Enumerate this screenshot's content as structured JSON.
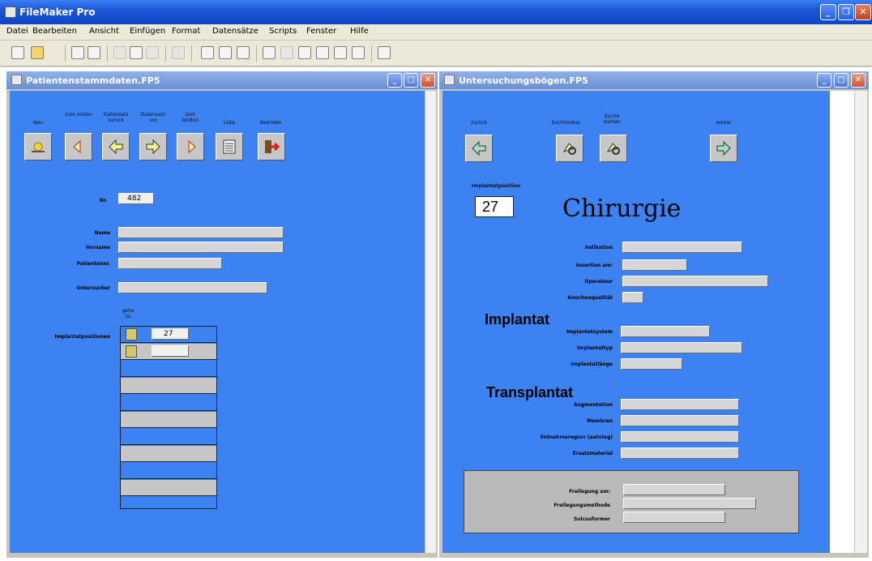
{
  "app": {
    "title": "FileMaker Pro"
  },
  "menu": [
    "Datei",
    "Bearbeiten",
    "Ansicht",
    "Einfügen",
    "Format",
    "Datensätze",
    "Scripts",
    "Fenster",
    "Hilfe"
  ],
  "left_window": {
    "title": "Patientenstammdaten.FP5",
    "nav": [
      {
        "label": "Neu",
        "icon": "sun-icon"
      },
      {
        "label": "zum ersten",
        "icon": "rewind-icon"
      },
      {
        "label": "Datensatz zurück",
        "icon": "arrow-left-icon"
      },
      {
        "label": "Datensatz vor",
        "icon": "arrow-right-icon"
      },
      {
        "label": "zum letzten",
        "icon": "fast-forward-icon"
      },
      {
        "label": "Liste",
        "icon": "list-icon"
      },
      {
        "label": "Beenden",
        "icon": "exit-icon"
      }
    ],
    "nr_label": "Nr.",
    "nr_value": "482",
    "name_label": "Name",
    "vorname_label": "Vorname",
    "patientennr_label": "Patientennr.",
    "untersucher_label": "Untersucher",
    "gehe_zu_label": "gehe zu",
    "implantat_label": "Implantatpositionen",
    "portal_values": [
      "27",
      ""
    ]
  },
  "right_window": {
    "title": "Untersuchungsbögen.FP5",
    "btn_zurueck": "zurück",
    "btn_suchmodus": "Suchmodus",
    "btn_suche_starten": "Suche starten",
    "btn_weiter": "weiter",
    "implantatposition_label": "Implantatposition",
    "implantatposition_value": "27",
    "heading": "Chirurgie",
    "indikation": "Indikation",
    "insertion": "Insertion am:",
    "operateur": "Operateur",
    "knochenqualitaet": "Knochenqualität",
    "implantat_heading": "Implantat",
    "implantatsystem": "Implantatsystem",
    "implantattyp": "Implantattyp",
    "implantatlaenge": "Implantatlänge",
    "transplantat_heading": "Transplantat",
    "augmentation": "Augmentation",
    "membran": "Membran",
    "entnahmeregion": "Entnahmeregion (autolog)",
    "ersatzmaterial": "Ersatzmaterial",
    "freilegung_am": "Freilegung am:",
    "freilegungsmethode": "Freilegungsmethode",
    "sulcusformer": "Sulcusformer"
  }
}
